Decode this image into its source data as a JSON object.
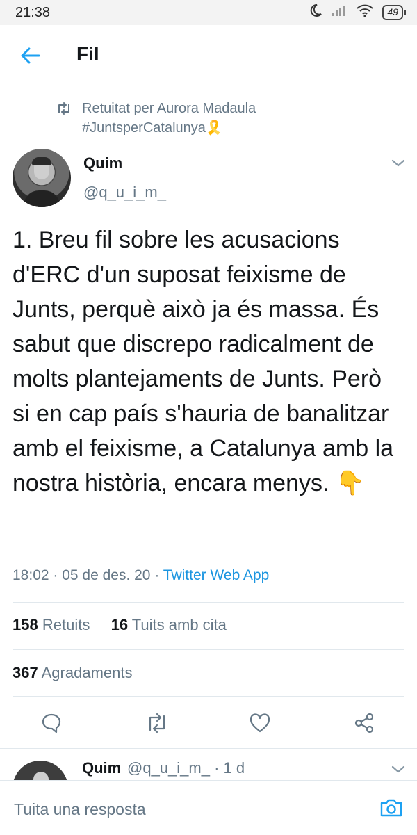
{
  "status_bar": {
    "time": "21:38",
    "battery": "49"
  },
  "header": {
    "title": "Fil"
  },
  "retweet": {
    "text": "Retuitat per Aurora Madaula",
    "hashtag": "#JuntsperCatalunya",
    "ribbon_emoji": "🎗️"
  },
  "tweet": {
    "author_name": "Quim",
    "author_handle": "@q_u_i_m_",
    "text": "1. Breu fil sobre les acusacions d'ERC d'un suposat feixisme de Junts, perquè això ja és massa. És sabut que discrepo radicalment de molts plantejaments de Junts. Però si en cap país s'hauria de banalitzar amb el feixisme, a Catalunya amb la nostra història, encara menys. 👇",
    "time": "18:02 · 05 de des. 20 · ",
    "app": "Twitter Web App",
    "retweets_count": "158",
    "retweets_label": "Retuits",
    "quotes_count": "16",
    "quotes_label": "Tuits amb cita",
    "likes_count": "367",
    "likes_label": "Agradaments"
  },
  "reply_preview": {
    "author_name": "Quim",
    "meta": "@q_u_i_m_ · 1 d"
  },
  "composer": {
    "placeholder": "Tuita una resposta"
  },
  "colors": {
    "accent": "#1da1f2",
    "link": "#1b95e0",
    "muted": "#657786",
    "border": "#e1e8ed"
  },
  "icons": [
    "back-arrow-icon",
    "retweet-icon",
    "chevron-down-icon",
    "reply-icon",
    "like-icon",
    "share-icon",
    "camera-icon"
  ]
}
